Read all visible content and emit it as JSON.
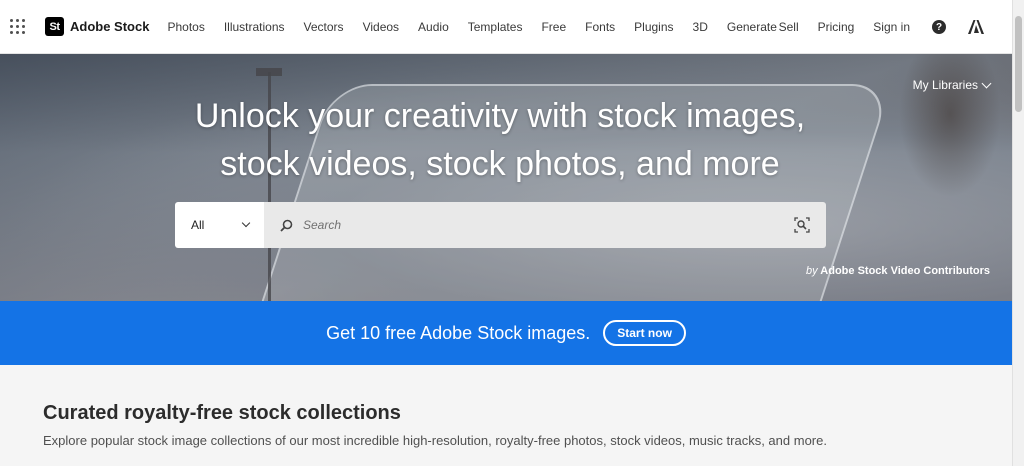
{
  "header": {
    "brand": {
      "logo_text": "St",
      "name": "Adobe Stock"
    },
    "nav": [
      "Photos",
      "Illustrations",
      "Vectors",
      "Videos",
      "Audio",
      "Templates",
      "Free",
      "Fonts",
      "Plugins",
      "3D",
      "Generate"
    ],
    "right": {
      "sell": "Sell",
      "pricing": "Pricing",
      "sign_in": "Sign in",
      "help_symbol": "?"
    },
    "icons": [
      "apps-grid-icon",
      "help-icon",
      "adobe-icon"
    ]
  },
  "hero": {
    "my_libraries": "My Libraries",
    "headline_line1": "Unlock your creativity with stock images,",
    "headline_line2": "stock videos, stock photos, and more",
    "search": {
      "category": "All",
      "placeholder": "Search"
    },
    "credit_prefix": "by",
    "credit_name": "Adobe Stock Video Contributors"
  },
  "promo": {
    "text": "Get 10 free Adobe Stock images.",
    "button": "Start now",
    "color": "#1473e6"
  },
  "collections": {
    "title": "Curated royalty-free stock collections",
    "subtitle": "Explore popular stock image collections of our most incredible high-resolution, royalty-free photos, stock videos, music tracks, and more."
  }
}
